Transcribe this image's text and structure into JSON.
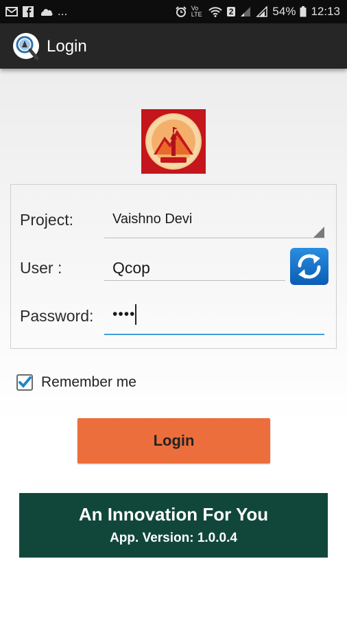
{
  "status_bar": {
    "left_more": "...",
    "battery_percent": "54%",
    "time": "12:13",
    "volte": "Vo LTE",
    "sim_slot": "2"
  },
  "app_bar": {
    "title": "Login"
  },
  "form": {
    "project_label": "Project:",
    "project_value": "Vaishno Devi",
    "user_label": "User :",
    "user_value": "Qcop",
    "password_label": "Password:",
    "password_value": "••••"
  },
  "remember": {
    "label": "Remember me",
    "checked": true
  },
  "login_button": {
    "label": "Login"
  },
  "footer": {
    "title": "An Innovation For You",
    "version": "App. Version: 1.0.0.4"
  },
  "colors": {
    "login_button": "#ec6e3c",
    "footer_bg": "#11473b",
    "accent": "#3f9fd8",
    "emblem_bg": "#c4161c"
  }
}
